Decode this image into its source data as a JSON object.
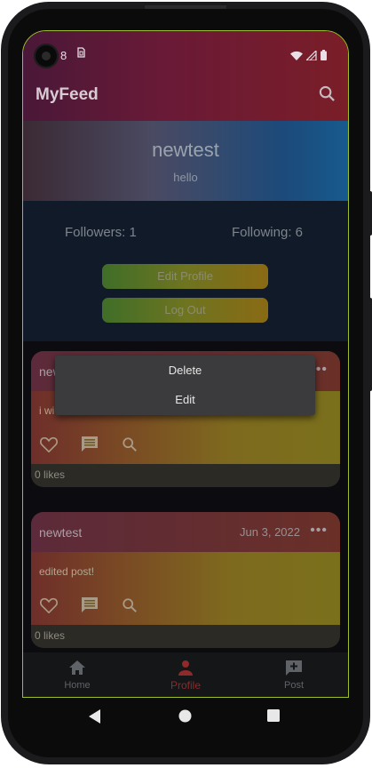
{
  "status_bar": {
    "time": "8",
    "sim_icon": "sim-icon",
    "icons": [
      "wifi-icon",
      "signal-icon",
      "battery-icon"
    ]
  },
  "app_bar": {
    "title": "MyFeed",
    "search_icon": "search-icon"
  },
  "profile": {
    "username": "newtest",
    "bio": "hello",
    "followers_label": "Followers: 1",
    "following_label": "Following: 6",
    "edit_profile_label": "Edit Profile",
    "logout_label": "Log Out"
  },
  "posts": [
    {
      "author": "newtest",
      "author_visible": "new",
      "date": "",
      "text": "i wi",
      "likes": "0 likes"
    },
    {
      "author": "newtest",
      "date": "Jun 3, 2022",
      "text": "edited post!",
      "likes": "0 likes"
    }
  ],
  "context_menu": {
    "items": [
      "Delete",
      "Edit"
    ]
  },
  "bottom_nav": {
    "items": [
      {
        "label": "Home",
        "icon": "home-icon",
        "active": false
      },
      {
        "label": "Profile",
        "icon": "person-icon",
        "active": true
      },
      {
        "label": "Post",
        "icon": "add-post-icon",
        "active": false
      }
    ]
  },
  "colors": {
    "active_nav": "#8e2a2a",
    "inactive_nav": "#5f6266",
    "menu_bg": "#3b3b3d"
  }
}
